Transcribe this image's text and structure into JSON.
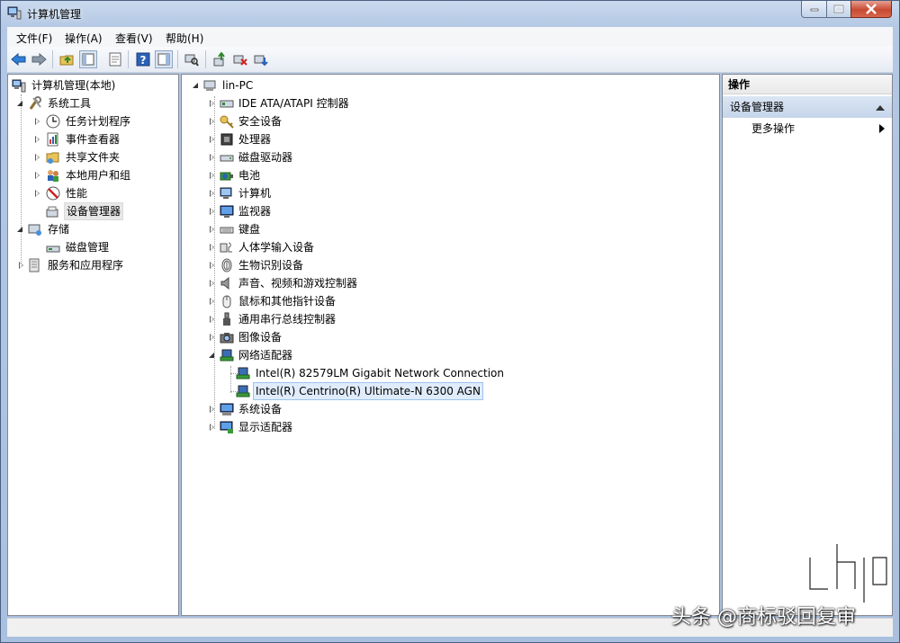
{
  "window": {
    "title": "计算机管理"
  },
  "menu": [
    "文件(F)",
    "操作(A)",
    "查看(V)",
    "帮助(H)"
  ],
  "toolbar": {
    "buttons": [
      "back-icon",
      "forward-icon",
      "up-folder-icon",
      "show-hide-tree-icon",
      "properties-icon",
      "help-icon",
      "show-hide-action-icon",
      "scan-hardware-icon",
      "update-driver-icon",
      "disable-device-icon",
      "uninstall-device-icon"
    ]
  },
  "left_tree": {
    "root": "计算机管理(本地)",
    "system_tools": "系统工具",
    "task_scheduler": "任务计划程序",
    "event_viewer": "事件查看器",
    "shared_folders": "共享文件夹",
    "local_users": "本地用户和组",
    "performance": "性能",
    "device_manager": "设备管理器",
    "storage": "存储",
    "disk_management": "磁盘管理",
    "services_apps": "服务和应用程序"
  },
  "device_tree": {
    "root": "lin-PC",
    "categories": [
      {
        "label": "IDE ATA/ATAPI 控制器",
        "icon": "ide-controller-icon"
      },
      {
        "label": "安全设备",
        "icon": "security-key-icon"
      },
      {
        "label": "处理器",
        "icon": "processor-icon"
      },
      {
        "label": "磁盘驱动器",
        "icon": "disk-drive-icon"
      },
      {
        "label": "电池",
        "icon": "battery-icon"
      },
      {
        "label": "计算机",
        "icon": "computer-icon"
      },
      {
        "label": "监视器",
        "icon": "monitor-icon"
      },
      {
        "label": "键盘",
        "icon": "keyboard-icon"
      },
      {
        "label": "人体学输入设备",
        "icon": "hid-icon"
      },
      {
        "label": "生物识别设备",
        "icon": "fingerprint-icon"
      },
      {
        "label": "声音、视频和游戏控制器",
        "icon": "speaker-icon"
      },
      {
        "label": "鼠标和其他指针设备",
        "icon": "mouse-icon"
      },
      {
        "label": "通用串行总线控制器",
        "icon": "usb-icon"
      },
      {
        "label": "图像设备",
        "icon": "camera-icon"
      },
      {
        "label": "网络适配器",
        "icon": "network-adapter-icon"
      },
      {
        "label": "系统设备",
        "icon": "system-device-icon"
      },
      {
        "label": "显示适配器",
        "icon": "display-adapter-icon"
      }
    ],
    "network_children": [
      "Intel(R) 82579LM Gigabit Network Connection",
      "Intel(R) Centrino(R) Ultimate-N 6300 AGN"
    ]
  },
  "actions": {
    "header": "操作",
    "section": "设备管理器",
    "more": "更多操作"
  },
  "watermark": {
    "text": "头条 @商标驳回复审",
    "logo_text": "chip"
  },
  "colors": {
    "selection_blue": "#e0ecfb",
    "title_gradient": "#b3c8e4",
    "close_red": "#c74a32"
  }
}
